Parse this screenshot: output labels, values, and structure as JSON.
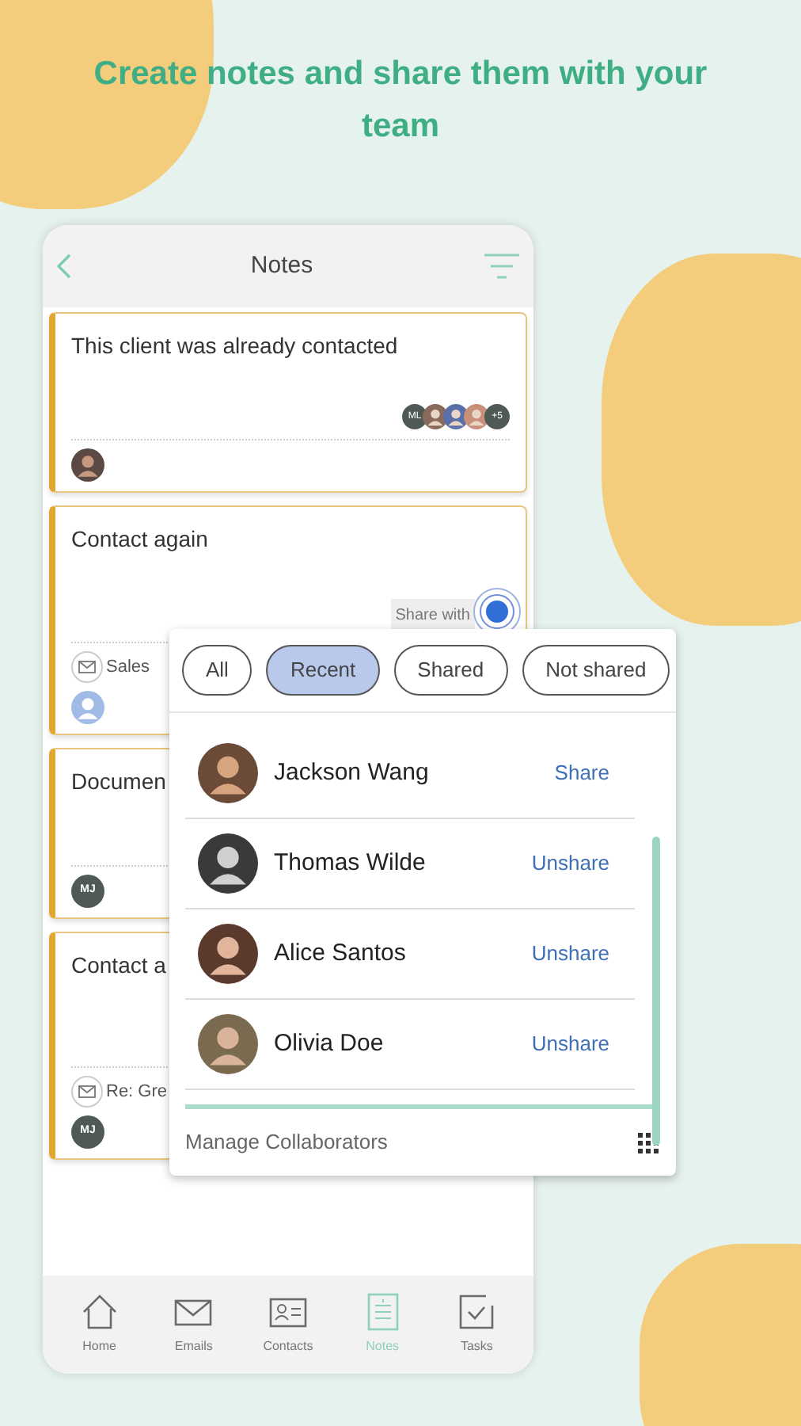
{
  "headline": "Create notes and share them with your team",
  "header": {
    "title": "Notes"
  },
  "notes": [
    {
      "title": "This client was already contacted",
      "shared_with": {
        "initials": "ML",
        "more": "+5"
      },
      "author": {
        "kind": "photo"
      }
    },
    {
      "title": "Contact again",
      "share_button": "Share with",
      "email": "Sales",
      "author": {
        "kind": "generic"
      }
    },
    {
      "title": "Documen",
      "author": {
        "kind": "initials",
        "initials": "MJ"
      }
    },
    {
      "title": "Contact a",
      "email": "Re: Gre",
      "author": {
        "kind": "initials",
        "initials": "MJ"
      }
    }
  ],
  "share_popup": {
    "filters": [
      {
        "label": "All",
        "selected": false
      },
      {
        "label": "Recent",
        "selected": true
      },
      {
        "label": "Shared",
        "selected": false
      },
      {
        "label": "Not shared",
        "selected": false
      }
    ],
    "people": [
      {
        "name": "Jackson Wang",
        "action": "Share"
      },
      {
        "name": "Thomas Wilde",
        "action": "Unshare"
      },
      {
        "name": "Alice Santos",
        "action": "Unshare"
      },
      {
        "name": "Olivia Doe",
        "action": "Unshare"
      }
    ],
    "footer": "Manage Collaborators"
  },
  "nav": [
    {
      "label": "Home",
      "selected": false
    },
    {
      "label": "Emails",
      "selected": false
    },
    {
      "label": "Contacts",
      "selected": false
    },
    {
      "label": "Notes",
      "selected": true
    },
    {
      "label": "Tasks",
      "selected": false
    }
  ]
}
